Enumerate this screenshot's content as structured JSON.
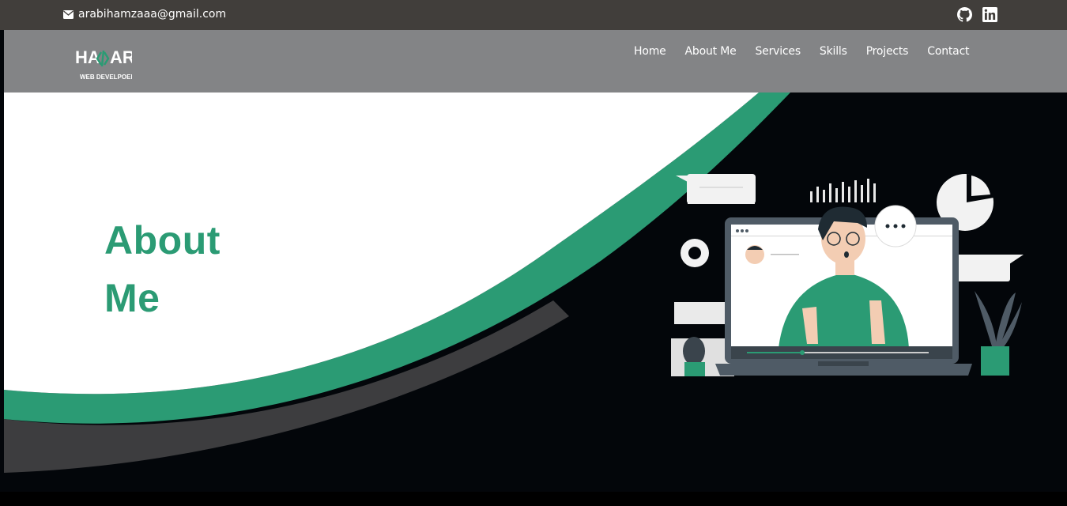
{
  "topbar": {
    "email": "arabihamzaaa@gmail.com",
    "icons": {
      "mail": "mail-icon",
      "github": "github-icon",
      "linkedin": "linkedin-icon"
    }
  },
  "logo": {
    "line1_left": "HA",
    "line1_right": "AR",
    "line2": "WEB DEVELPOER"
  },
  "nav": {
    "items": [
      {
        "label": "Home"
      },
      {
        "label": "About Me"
      },
      {
        "label": "Services"
      },
      {
        "label": "Skills"
      },
      {
        "label": "Projects"
      },
      {
        "label": "Contact"
      }
    ]
  },
  "hero": {
    "title_line1": "About",
    "title_line2": "Me"
  },
  "colors": {
    "accent": "#2b9b74",
    "navbar": "#838486",
    "topbar": "#413e3b",
    "dark_bg": "#03060a",
    "white": "#ffffff"
  }
}
